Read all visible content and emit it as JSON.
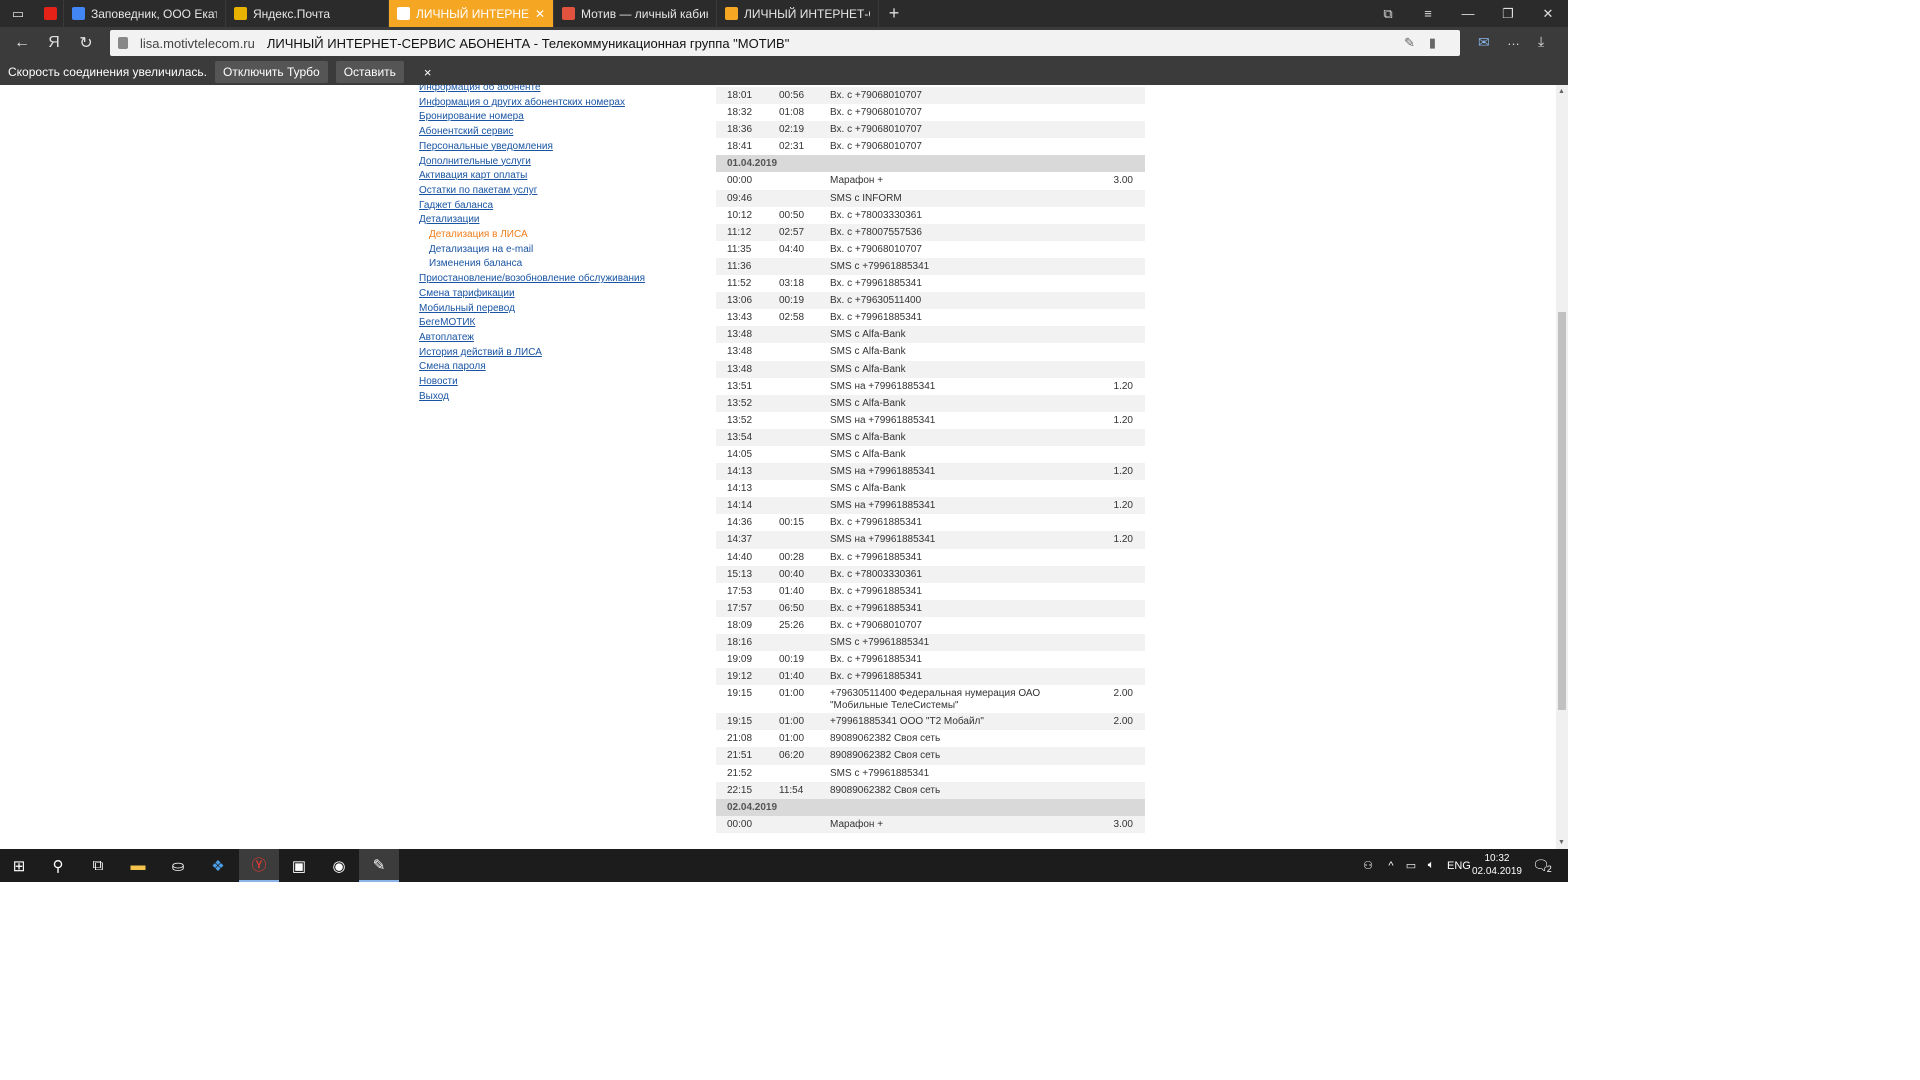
{
  "browser": {
    "tabs": [
      {
        "title": "",
        "icon": "youtube-icon"
      },
      {
        "title": "Заповедник, ООО Екатери",
        "icon": "google-icon"
      },
      {
        "title": "Яндекс.Почта",
        "icon": "mail-icon"
      },
      {
        "title": "ЛИЧНЫЙ ИНТЕРНЕТ-СЕ",
        "icon": "motiv-icon",
        "active": true
      },
      {
        "title": "Мотив — личный кабинет",
        "icon": "motiv-red-icon"
      },
      {
        "title": "ЛИЧНЫЙ ИНТЕРНЕТ-СЕРВ",
        "icon": "motiv-icon"
      }
    ],
    "address": {
      "domain": "lisa.motivtelecom.ru",
      "page_title": "ЛИЧНЫЙ ИНТЕРНЕТ-СЕРВИС АБОНЕНТА - Телекоммуникационная группа \"МОТИВ\""
    },
    "turbo": {
      "message": "Скорость соединения увеличилась.",
      "disable_label": "Отключить Турбо",
      "keep_label": "Оставить",
      "close_label": "×"
    }
  },
  "menu": {
    "items": [
      {
        "label": "Информация об абоненте"
      },
      {
        "label": "Информация о других абонентских номерах"
      },
      {
        "label": "Бронирование номера"
      },
      {
        "label": "Абонентский сервис"
      },
      {
        "label": "Персональные уведомления"
      },
      {
        "label": "Дополнительные услуги"
      },
      {
        "label": "Активация карт оплаты"
      },
      {
        "label": "Остатки по пакетам услуг"
      },
      {
        "label": "Гаджет баланса"
      },
      {
        "label": "Детализации"
      },
      {
        "label": "Детализация в ЛИСА",
        "sub": true,
        "current": true
      },
      {
        "label": "Детализация на e-mail",
        "sub": true
      },
      {
        "label": "Изменения баланса",
        "sub": true
      },
      {
        "label": "Приостановление/возобновление обслуживания"
      },
      {
        "label": "Смена тарификации"
      },
      {
        "label": "Мобильный перевод"
      },
      {
        "label": "БегеМОТИК"
      },
      {
        "label": "Автоплатеж"
      },
      {
        "label": "История действий в ЛИСА"
      },
      {
        "label": "Смена пароля"
      },
      {
        "label": "Новости"
      },
      {
        "label": "Выход"
      }
    ]
  },
  "details": {
    "rows": [
      {
        "time": "18:01",
        "dur": "00:56",
        "desc": "Вх. с +79068010707",
        "cost": ""
      },
      {
        "time": "18:32",
        "dur": "01:08",
        "desc": "Вх. с +79068010707",
        "cost": ""
      },
      {
        "time": "18:36",
        "dur": "02:19",
        "desc": "Вх. с +79068010707",
        "cost": ""
      },
      {
        "time": "18:41",
        "dur": "02:31",
        "desc": "Вх. с +79068010707",
        "cost": ""
      },
      {
        "date": "01.04.2019"
      },
      {
        "time": "00:00",
        "dur": "",
        "desc": "Марафон +",
        "cost": "3.00"
      },
      {
        "time": "09:46",
        "dur": "",
        "desc": "SMS с INFORM",
        "cost": ""
      },
      {
        "time": "10:12",
        "dur": "00:50",
        "desc": "Вх. с +78003330361",
        "cost": ""
      },
      {
        "time": "11:12",
        "dur": "02:57",
        "desc": "Вх. с +78007557536",
        "cost": ""
      },
      {
        "time": "11:35",
        "dur": "04:40",
        "desc": "Вх. с +79068010707",
        "cost": ""
      },
      {
        "time": "11:36",
        "dur": "",
        "desc": "SMS с +79961885341",
        "cost": ""
      },
      {
        "time": "11:52",
        "dur": "03:18",
        "desc": "Вх. с +79961885341",
        "cost": ""
      },
      {
        "time": "13:06",
        "dur": "00:19",
        "desc": "Вх. с +79630511400",
        "cost": ""
      },
      {
        "time": "13:43",
        "dur": "02:58",
        "desc": "Вх. с +79961885341",
        "cost": ""
      },
      {
        "time": "13:48",
        "dur": "",
        "desc": "SMS с Alfa-Bank",
        "cost": ""
      },
      {
        "time": "13:48",
        "dur": "",
        "desc": "SMS с Alfa-Bank",
        "cost": ""
      },
      {
        "time": "13:48",
        "dur": "",
        "desc": "SMS с Alfa-Bank",
        "cost": ""
      },
      {
        "time": "13:51",
        "dur": "",
        "desc": "SMS на +79961885341",
        "cost": "1.20"
      },
      {
        "time": "13:52",
        "dur": "",
        "desc": "SMS с Alfa-Bank",
        "cost": ""
      },
      {
        "time": "13:52",
        "dur": "",
        "desc": "SMS на +79961885341",
        "cost": "1.20"
      },
      {
        "time": "13:54",
        "dur": "",
        "desc": "SMS с Alfa-Bank",
        "cost": ""
      },
      {
        "time": "14:05",
        "dur": "",
        "desc": "SMS с Alfa-Bank",
        "cost": ""
      },
      {
        "time": "14:13",
        "dur": "",
        "desc": "SMS на +79961885341",
        "cost": "1.20"
      },
      {
        "time": "14:13",
        "dur": "",
        "desc": "SMS с Alfa-Bank",
        "cost": ""
      },
      {
        "time": "14:14",
        "dur": "",
        "desc": "SMS на +79961885341",
        "cost": "1.20"
      },
      {
        "time": "14:36",
        "dur": "00:15",
        "desc": "Вх. с +79961885341",
        "cost": ""
      },
      {
        "time": "14:37",
        "dur": "",
        "desc": "SMS на +79961885341",
        "cost": "1.20"
      },
      {
        "time": "14:40",
        "dur": "00:28",
        "desc": "Вх. с +79961885341",
        "cost": ""
      },
      {
        "time": "15:13",
        "dur": "00:40",
        "desc": "Вх. с +78003330361",
        "cost": ""
      },
      {
        "time": "17:53",
        "dur": "01:40",
        "desc": "Вх. с +79961885341",
        "cost": ""
      },
      {
        "time": "17:57",
        "dur": "06:50",
        "desc": "Вх. с +79961885341",
        "cost": ""
      },
      {
        "time": "18:09",
        "dur": "25:26",
        "desc": "Вх. с +79068010707",
        "cost": ""
      },
      {
        "time": "18:16",
        "dur": "",
        "desc": "SMS с +79961885341",
        "cost": ""
      },
      {
        "time": "19:09",
        "dur": "00:19",
        "desc": "Вх. с +79961885341",
        "cost": ""
      },
      {
        "time": "19:12",
        "dur": "01:40",
        "desc": "Вх. с +79961885341",
        "cost": ""
      },
      {
        "time": "19:15",
        "dur": "01:00",
        "desc": "+79630511400 Федеральная нумерация ОАО \"Мобильные ТелеСистемы\"",
        "cost": "2.00"
      },
      {
        "time": "19:15",
        "dur": "01:00",
        "desc": "+79961885341 ООО \"Т2 Мобайл\"",
        "cost": "2.00"
      },
      {
        "time": "21:08",
        "dur": "01:00",
        "desc": "89089062382 Своя сеть",
        "cost": ""
      },
      {
        "time": "21:51",
        "dur": "06:20",
        "desc": "89089062382 Своя сеть",
        "cost": ""
      },
      {
        "time": "21:52",
        "dur": "",
        "desc": "SMS с +79961885341",
        "cost": ""
      },
      {
        "time": "22:15",
        "dur": "11:54",
        "desc": "89089062382 Своя сеть",
        "cost": ""
      },
      {
        "date": "02.04.2019"
      },
      {
        "time": "00:00",
        "dur": "",
        "desc": "Марафон +",
        "cost": "3.00"
      }
    ]
  },
  "taskbar": {
    "lang": "ENG",
    "time": "10:32",
    "date": "02.04.2019",
    "notifications": "2"
  },
  "colors": {
    "active_tab": "#f5a623",
    "link": "#1a55a3",
    "current_link": "#f07d1a",
    "date_row_bg": "#d9d9d9",
    "odd_row_bg": "#f2f2f2"
  }
}
